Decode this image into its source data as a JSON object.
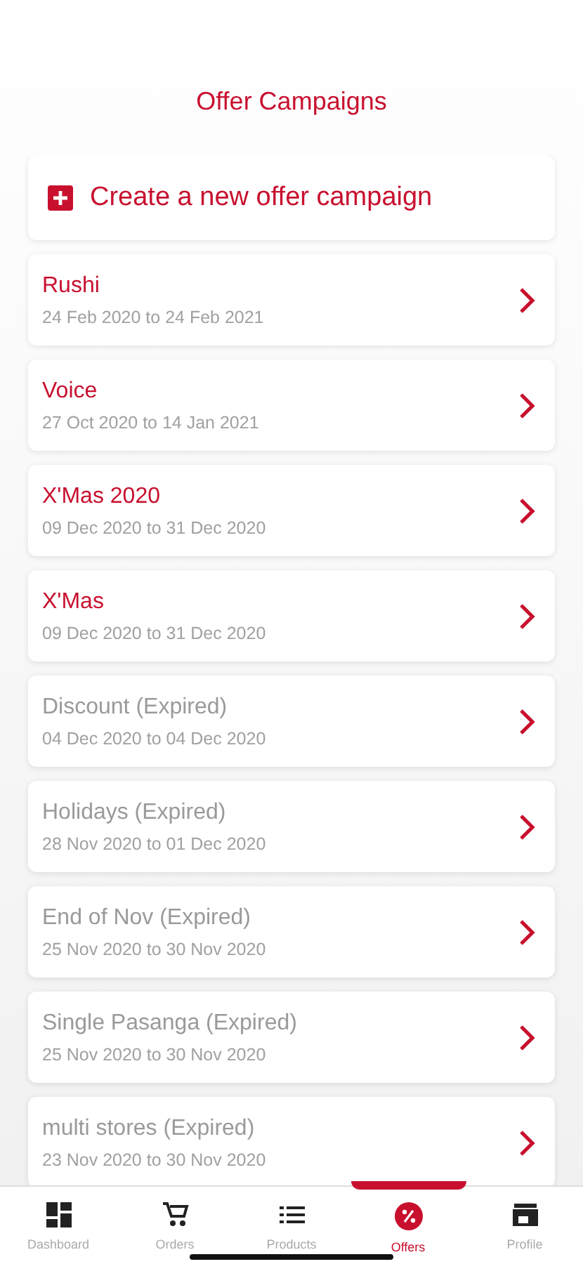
{
  "title": "Offer Campaigns",
  "create_button": {
    "label": "Create a new offer campaign"
  },
  "campaigns": [
    {
      "name": "Rushi",
      "dates": "24 Feb 2020 to 24 Feb 2021",
      "expired": false
    },
    {
      "name": "Voice",
      "dates": "27 Oct 2020 to 14 Jan 2021",
      "expired": false
    },
    {
      "name": "X'Mas 2020",
      "dates": "09 Dec 2020 to 31 Dec 2020",
      "expired": false
    },
    {
      "name": "X'Mas",
      "dates": "09 Dec 2020 to 31 Dec 2020",
      "expired": false
    },
    {
      "name": "Discount (Expired)",
      "dates": "04 Dec 2020 to 04 Dec 2020",
      "expired": true
    },
    {
      "name": "Holidays (Expired)",
      "dates": "28 Nov 2020 to 01 Dec 2020",
      "expired": true
    },
    {
      "name": "End of Nov (Expired)",
      "dates": "25 Nov 2020 to 30 Nov 2020",
      "expired": true
    },
    {
      "name": "Single Pasanga (Expired)",
      "dates": "25 Nov 2020 to 30 Nov 2020",
      "expired": true
    },
    {
      "name": "multi stores (Expired)",
      "dates": "23 Nov 2020 to 30 Nov 2020",
      "expired": true
    }
  ],
  "tabs": [
    {
      "label": "Dashboard",
      "kind": "dashboard",
      "selected": false
    },
    {
      "label": "Orders",
      "kind": "orders",
      "selected": false
    },
    {
      "label": "Products",
      "kind": "products",
      "selected": false
    },
    {
      "label": "Offers",
      "kind": "offers",
      "selected": true
    },
    {
      "label": "Profile",
      "kind": "profile",
      "selected": false
    }
  ]
}
